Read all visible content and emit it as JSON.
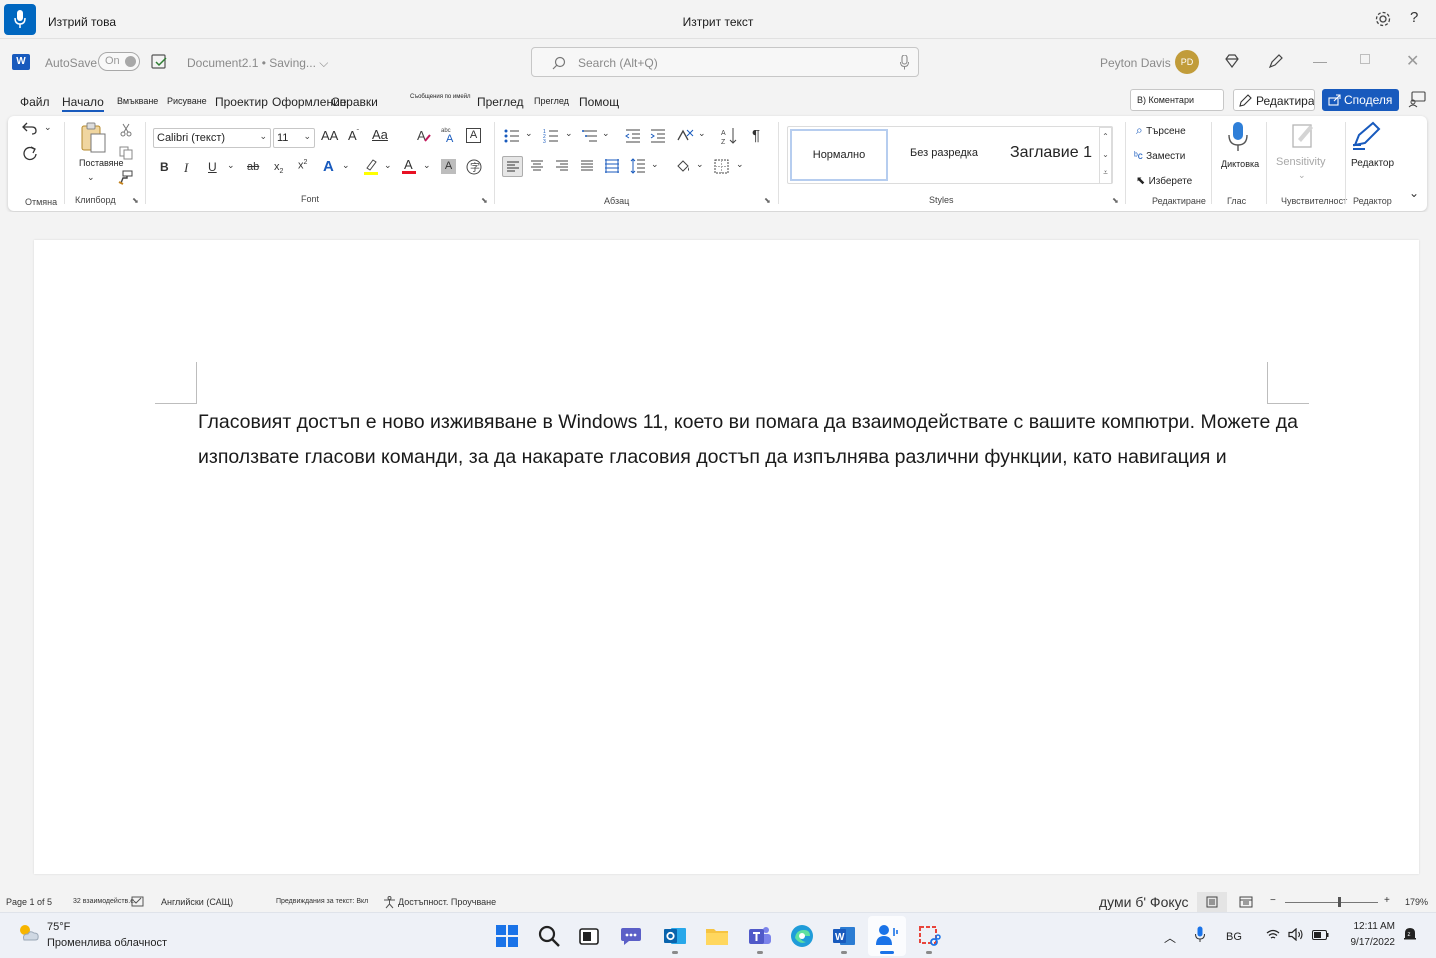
{
  "voice": {
    "status": "Изтрий това",
    "heard": "Изтрит текст",
    "help": "?"
  },
  "titlebar": {
    "autosave_label": "AutoSave",
    "autosave_state": "On",
    "doc_name": "Document2.1 • Saving... ⌵",
    "search_placeholder": "Search (Alt+Q)",
    "user_name": "Peyton Davis",
    "user_initials": "PD",
    "app_letter": "W",
    "min": "—",
    "close": "✕"
  },
  "tabs": {
    "file": "Файл",
    "home": "Начало",
    "insert": "Вмъкване",
    "draw": "Рисуване",
    "design": "Проектир",
    "layout": "Оформление",
    "references": "Справки",
    "mailings": "Съобщения по имейл",
    "review": "Преглед",
    "view": "Преглед",
    "help": "Помощ",
    "comments": "В) Коментари",
    "editing": "Редактиране",
    "share": "Споделя"
  },
  "ribbon": {
    "undo_group": "Отмяна",
    "clipboard_group": "Клипборд",
    "paste_label": "Поставяне",
    "font_group": "Font",
    "font_name": "Calibri (текст)",
    "font_size": "11",
    "paragraph_group": "Абзац",
    "styles_group": "Styles",
    "style_normal": "Нормално",
    "style_nospacing": "Без разредка",
    "style_heading1": "Заглавие 1",
    "find": "Търсене",
    "replace": "Замести",
    "select": "Изберете",
    "editing_group": "Редактиране",
    "dictate": "Диктовка",
    "voice_group": "Глас",
    "sensitivity": "Sensitivity",
    "sensitivity_group": "Чувствителност",
    "editor": "Редактор",
    "editor_group": "Редактор"
  },
  "document": {
    "text": "Гласовият достъп е ново изживяване в Windows 11, което ви помага да взаимодействате с вашите компютри. Можете да използвате гласови команди, за да накарате гласовия достъп да изпълнява различни функции, като навигация и"
  },
  "status": {
    "page": "Page 1 of 5",
    "words": "32 взаимодейств.е.",
    "language": "Английски (САЩ)",
    "predictions": "Предвиждания за текст: Вкл",
    "accessibility": "Достъпност. Проучване",
    "focus": "думи б' Фокус",
    "zoom": "179%"
  },
  "taskbar": {
    "temp": "75°F",
    "weather": "Променлива облачност",
    "lang": "BG",
    "time": "12:11 AM",
    "date": "9/17/2022"
  },
  "colors": {
    "accent": "#185abd",
    "voice_mic": "#0067c0",
    "highlight": "#ffff00",
    "font_color": "#e81123"
  }
}
